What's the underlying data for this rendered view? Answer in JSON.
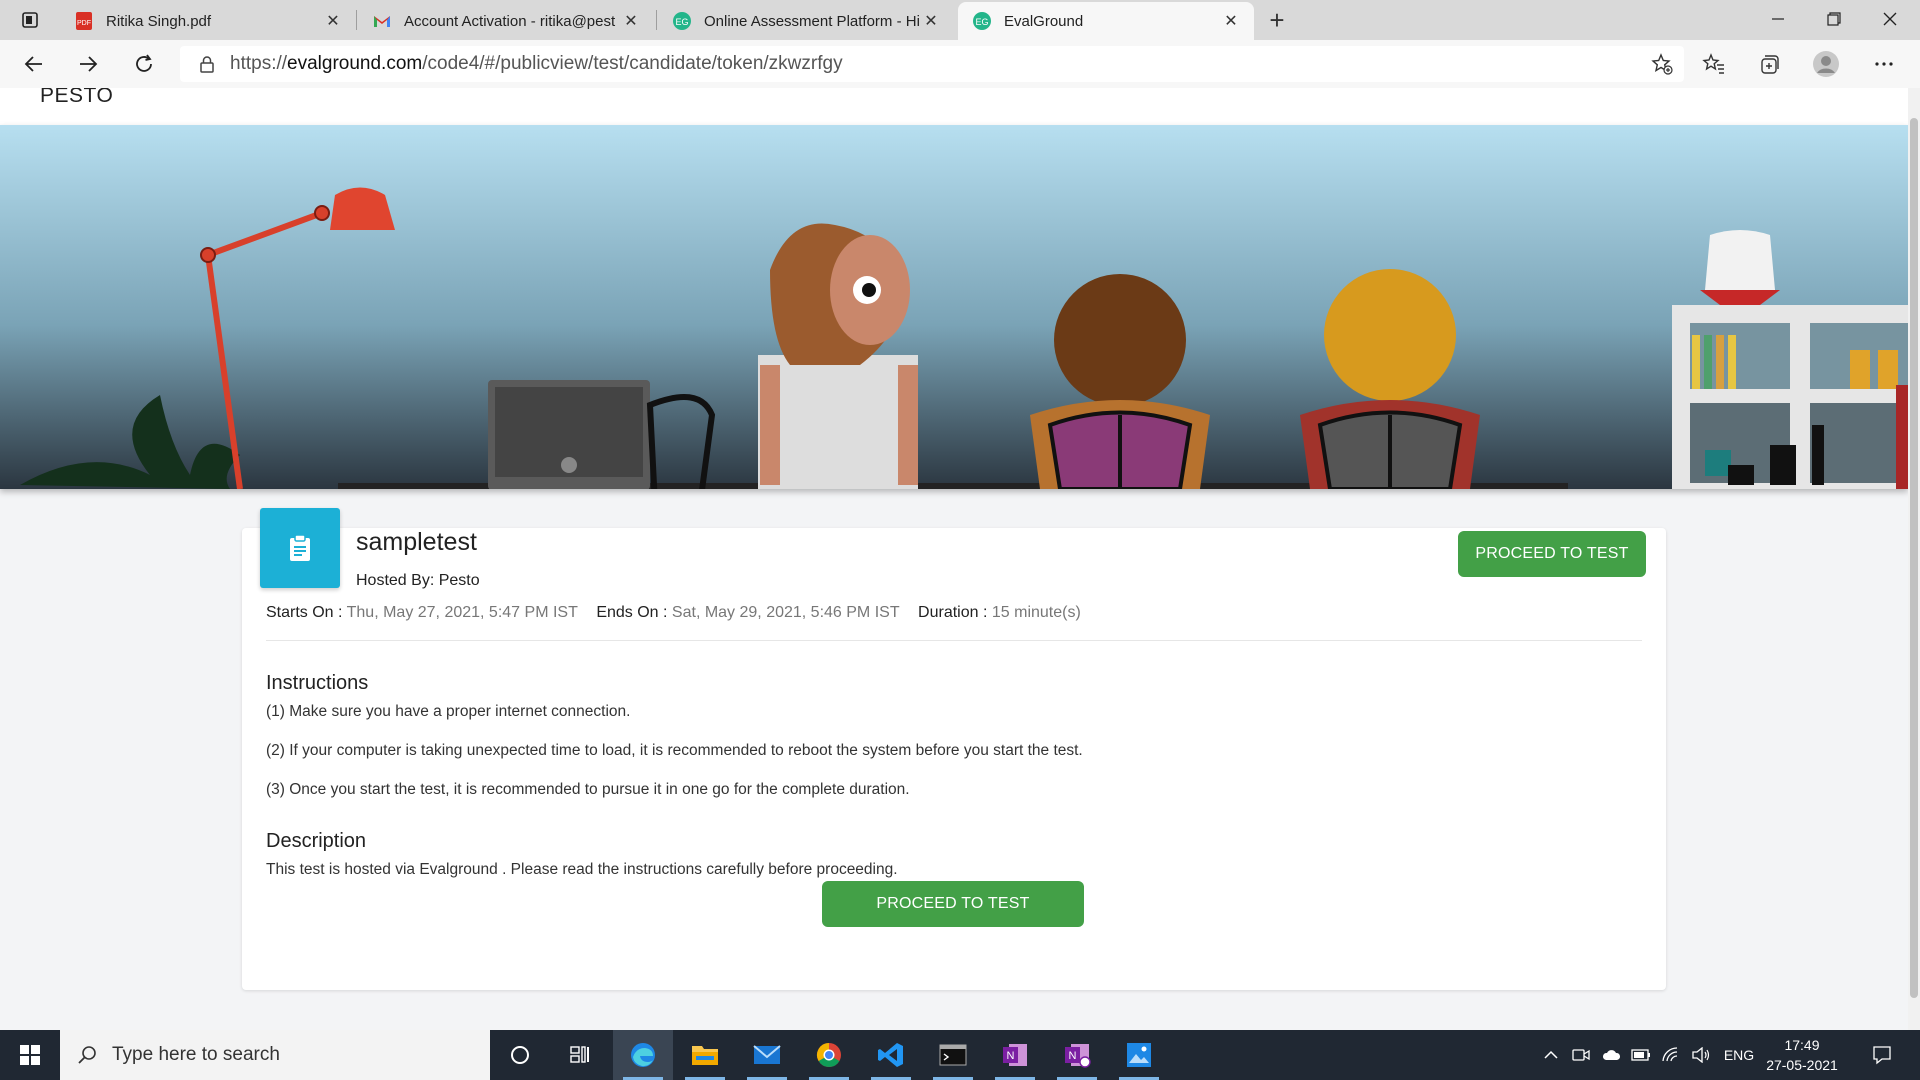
{
  "browser": {
    "tabs": [
      {
        "label": "Ritika Singh.pdf",
        "icon": "pdf-icon"
      },
      {
        "label": "Account Activation - ritika@pest",
        "icon": "gmail-icon"
      },
      {
        "label": "Online Assessment Platform - Hi",
        "icon": "evalground-icon"
      },
      {
        "label": "EvalGround",
        "icon": "evalground-icon",
        "active": true
      }
    ],
    "url_prefix": "https://",
    "url_domain": "evalground.com",
    "url_path": "/code4/#/publicview/test/candidate/token/zkwzrfgy"
  },
  "site": {
    "brand": "PESTO"
  },
  "test": {
    "title": "sampletest",
    "hosted_label": "Hosted By:",
    "hosted_by": "Pesto",
    "proceed_label": "PROCEED TO TEST",
    "starts_label": "Starts On :",
    "starts_value": "Thu, May 27, 2021, 5:47 PM IST",
    "ends_label": "Ends On :",
    "ends_value": "Sat, May 29, 2021, 5:46 PM IST",
    "duration_label": "Duration :",
    "duration_value": "15 minute(s)",
    "instructions_title": "Instructions",
    "instructions": [
      "(1) Make sure you have a proper internet connection.",
      "(2) If your computer is taking unexpected time to load, it is recommended to reboot the system before you start the test.",
      "(3) Once you start the test, it is recommended to pursue it in one go for the complete duration."
    ],
    "description_title": "Description",
    "description": "This test is hosted via Evalground . Please read the instructions carefully before proceeding."
  },
  "taskbar": {
    "search_placeholder": "Type here to search",
    "language": "ENG",
    "time": "17:49",
    "date": "27-05-2021",
    "apps": [
      "cortana-icon",
      "task-view-icon",
      "edge-icon",
      "file-explorer-icon",
      "mail-icon",
      "chrome-icon",
      "vscode-icon",
      "terminal-icon",
      "onenote-icon",
      "onenote-2-icon",
      "photos-icon"
    ]
  },
  "colors": {
    "accent_green": "#43a047",
    "test_icon_bg": "#1cb0d6",
    "taskbar_bg": "#202833"
  }
}
